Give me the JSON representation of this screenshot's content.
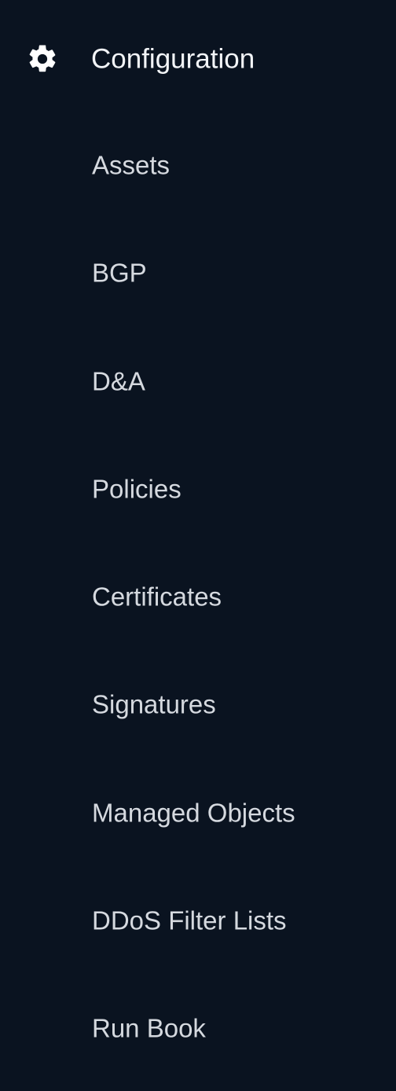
{
  "section": {
    "title": "Configuration",
    "icon": "gear-icon"
  },
  "items": [
    {
      "label": "Assets"
    },
    {
      "label": "BGP"
    },
    {
      "label": "D&A"
    },
    {
      "label": "Policies"
    },
    {
      "label": "Certificates"
    },
    {
      "label": "Signatures"
    },
    {
      "label": "Managed Objects"
    },
    {
      "label": "DDoS Filter Lists"
    },
    {
      "label": "Run Book"
    }
  ],
  "colors": {
    "background": "#0a1320",
    "title_text": "#f2f4f7",
    "item_text": "#d5d9df"
  }
}
